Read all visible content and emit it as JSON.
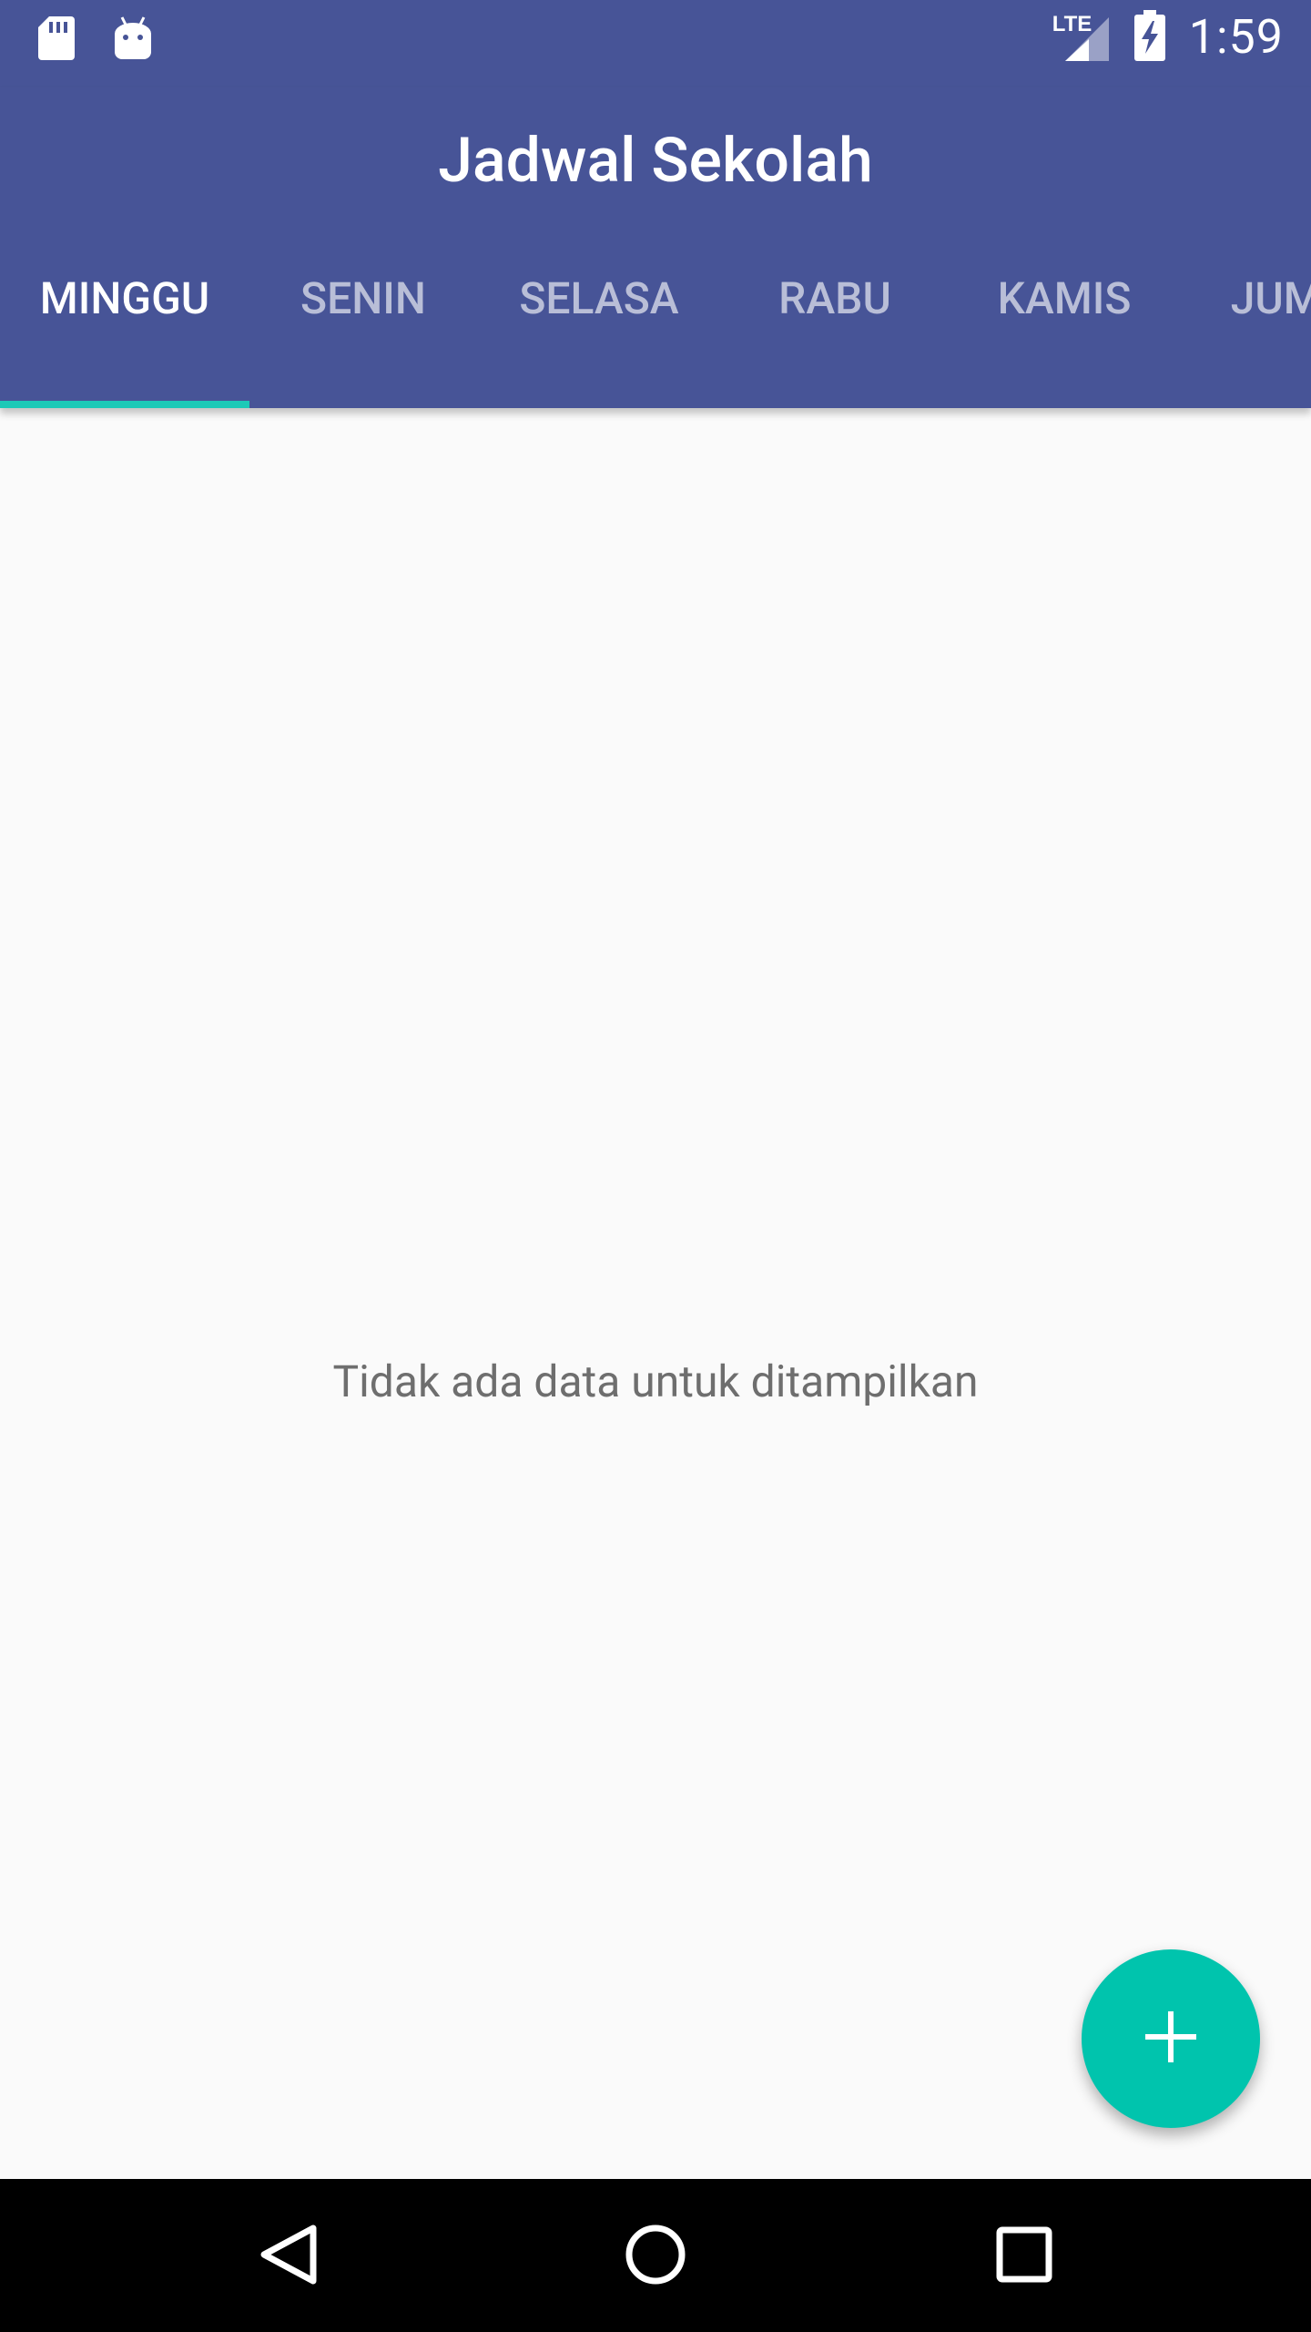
{
  "status_bar": {
    "left_icons": [
      "sd-card-icon",
      "android-debug-icon"
    ],
    "right_icons": [
      "lte-signal-icon",
      "battery-charging-icon"
    ],
    "network_label": "LTE",
    "time": "1:59"
  },
  "app_bar": {
    "title": "Jadwal Sekolah",
    "color": "#475497"
  },
  "tabs": [
    {
      "label": "MINGGU",
      "active": true
    },
    {
      "label": "SENIN",
      "active": false
    },
    {
      "label": "SELASA",
      "active": false
    },
    {
      "label": "RABU",
      "active": false
    },
    {
      "label": "KAMIS",
      "active": false
    },
    {
      "label": "JUMAT",
      "active": false
    }
  ],
  "indicator_color": "#1dc9b7",
  "content": {
    "empty_message": "Tidak ada data untuk ditampilkan"
  },
  "fab": {
    "icon": "plus-icon",
    "color": "#00c4ad"
  },
  "nav_bar": {
    "icons": [
      "back-icon",
      "home-icon",
      "recents-icon"
    ]
  }
}
